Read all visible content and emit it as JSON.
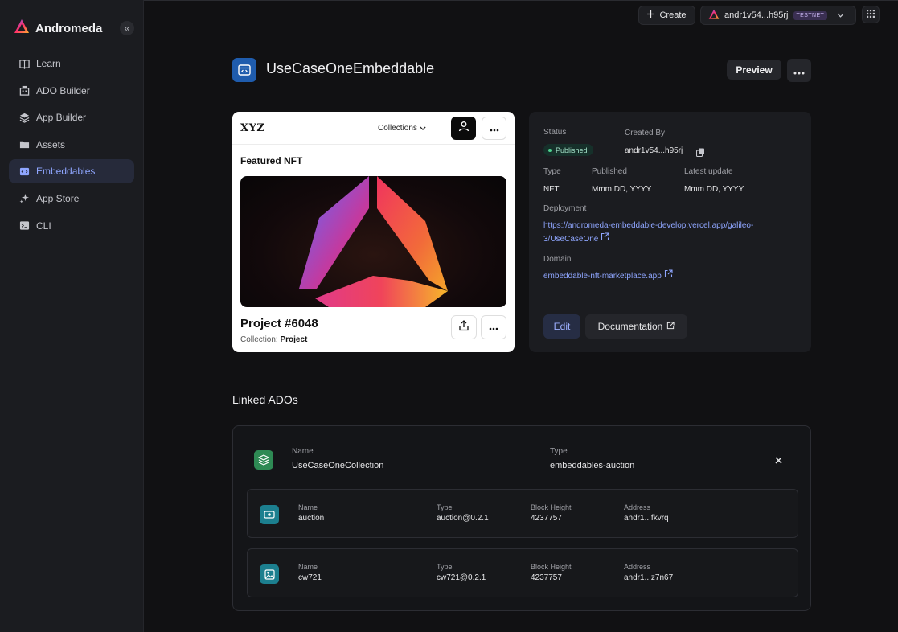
{
  "sidebar": {
    "brand": "Andromeda",
    "collapse_icon": "«",
    "items": [
      {
        "label": "Learn",
        "icon": "book-icon"
      },
      {
        "label": "ADO Builder",
        "icon": "building-icon"
      },
      {
        "label": "App Builder",
        "icon": "layers-icon"
      },
      {
        "label": "Assets",
        "icon": "folder-icon"
      },
      {
        "label": "Embeddables",
        "icon": "embed-icon",
        "active": true
      },
      {
        "label": "App Store",
        "icon": "sparkle-icon"
      },
      {
        "label": "CLI",
        "icon": "terminal-icon"
      }
    ]
  },
  "topbar": {
    "create_label": "Create",
    "wallet_address": "andr1v54...h95rj",
    "network_badge": "TESTNET"
  },
  "header": {
    "title": "UseCaseOneEmbeddable",
    "preview_label": "Preview"
  },
  "preview": {
    "logo": "XYZ",
    "collections_label": "Collections",
    "featured_label": "Featured NFT",
    "project_title": "Project #6048",
    "collection_prefix": "Collection:",
    "collection_name": "Project"
  },
  "info": {
    "status_label": "Status",
    "status_value": "Published",
    "created_by_label": "Created By",
    "created_by_value": "andr1v54...h95rj",
    "type_label": "Type",
    "type_value": "NFT",
    "published_label": "Published",
    "published_value": "Mmm DD, YYYY",
    "latest_update_label": "Latest update",
    "latest_update_value": "Mmm DD, YYYY",
    "deployment_label": "Deployment",
    "deployment_line1": "https://andromeda-embeddable-develop.vercel.app/galileo-",
    "deployment_line2": "3/UseCaseOne",
    "domain_label": "Domain",
    "domain_value": "embeddable-nft-marketplace.app",
    "edit_label": "Edit",
    "documentation_label": "Documentation"
  },
  "linked": {
    "title": "Linked ADOs",
    "collection": {
      "name_label": "Name",
      "name_value": "UseCaseOneCollection",
      "type_label": "Type",
      "type_value": "embeddables-auction"
    },
    "ados": [
      {
        "name_label": "Name",
        "name": "auction",
        "type_label": "Type",
        "type": "auction@0.2.1",
        "height_label": "Block Height",
        "height": "4237757",
        "address_label": "Address",
        "address": "andr1...fkvrq",
        "icon": "auction-icon"
      },
      {
        "name_label": "Name",
        "name": "cw721",
        "type_label": "Type",
        "type": "cw721@0.2.1",
        "height_label": "Block Height",
        "height": "4237757",
        "address_label": "Address",
        "address": "andr1...z7n67",
        "icon": "image-icon"
      }
    ]
  },
  "colors": {
    "accent": "#8fa6ff",
    "page_icon": "#1f5cad",
    "published_dot": "#4fd18f"
  }
}
